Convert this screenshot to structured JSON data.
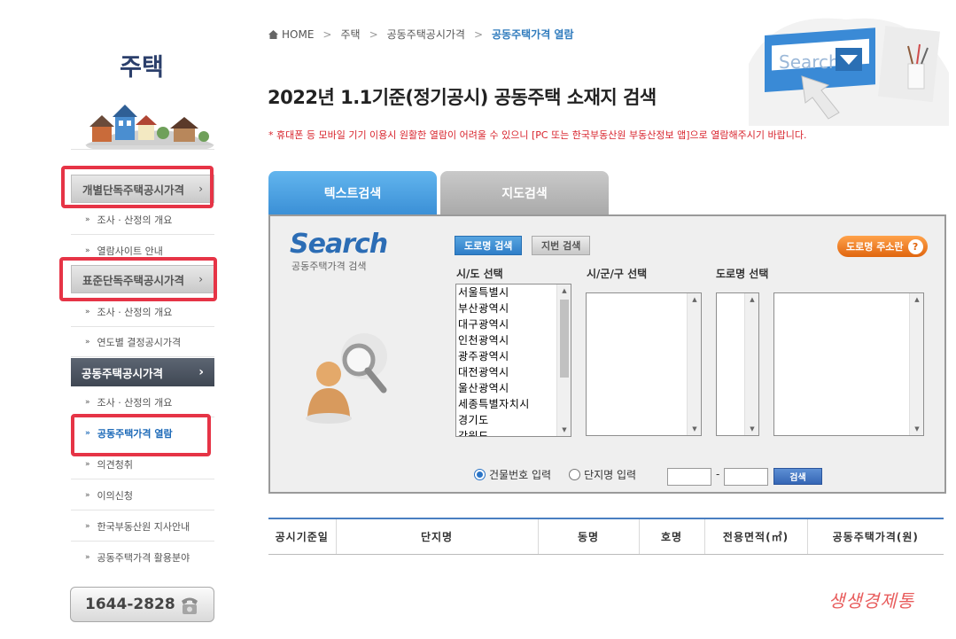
{
  "sidebar": {
    "title": "주택",
    "menus": [
      {
        "label": "개별단독주택공시가격",
        "chev": "›",
        "items": [
          "조사 · 산정의 개요",
          "열람사이트 안내"
        ]
      },
      {
        "label": "표준단독주택공시가격",
        "chev": "›",
        "items": [
          "조사 · 산정의 개요",
          "연도별 결정공시가격"
        ]
      },
      {
        "label": "공동주택공시가격",
        "chev": "›",
        "items": [
          "조사 · 산정의 개요",
          "공동주택가격 열람",
          "의견청취",
          "이의신청",
          "한국부동산원 지사안내",
          "공동주택가격 활용분야"
        ]
      }
    ],
    "bullet": "»",
    "phone": "1644-2828"
  },
  "breadcrumb": {
    "home": "HOME",
    "items": [
      "주택",
      "공동주택공시가격",
      "공동주택가격 열람"
    ],
    "sep": ">"
  },
  "page": {
    "title": "2022년 1.1기준(정기공시) 공동주택 소재지 검색",
    "notice": "* 휴대폰 등 모바일 기기 이용시 원활한 열람이 어려울 수 있으니 [PC 또는 한국부동산원 부동산정보 앱]으로 열람해주시기 바랍니다.",
    "header_search_text": "Search"
  },
  "tabs": [
    "텍스트검색",
    "지도검색"
  ],
  "search": {
    "logo": "Search",
    "logo_sub": "공동주택가격 검색",
    "btn_road": "도로명 검색",
    "btn_lot": "지번 검색",
    "btn_help": "도로명 주소란",
    "help_icon": "?",
    "label_sido": "시/도 선택",
    "label_sigungu": "시/군/구 선택",
    "label_road": "도로명 선택",
    "sido_options": [
      "서울특별시",
      "부산광역시",
      "대구광역시",
      "인천광역시",
      "광주광역시",
      "대전광역시",
      "울산광역시",
      "세종특별자치시",
      "경기도",
      "강원도"
    ],
    "radio_building": "건물번호 입력",
    "radio_complex": "단지명 입력",
    "radio_selected": "건물번호 입력",
    "dash": "-",
    "btn_search": "검색"
  },
  "table": {
    "headers": [
      "공시기준일",
      "단지명",
      "동명",
      "호명",
      "전용면적(㎡)",
      "공동주택가격(원)"
    ]
  },
  "watermark": "생생경제통",
  "colors": {
    "accent": "#2f7bbd",
    "notice": "#d8242d",
    "highlight": "#e63446"
  }
}
